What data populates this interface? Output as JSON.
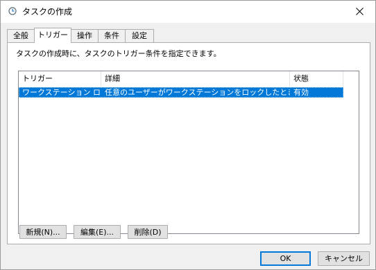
{
  "window": {
    "title": "タスクの作成"
  },
  "tabs": [
    {
      "label": "全般"
    },
    {
      "label": "トリガー"
    },
    {
      "label": "操作"
    },
    {
      "label": "条件"
    },
    {
      "label": "設定"
    }
  ],
  "panel": {
    "description": "タスクの作成時に、タスクのトリガー条件を指定できます。"
  },
  "table": {
    "columns": [
      "トリガー",
      "詳細",
      "状態"
    ],
    "rows": [
      {
        "trigger": "ワークステーション ロッ...",
        "detail": "任意のユーザーがワークステーションをロックしたとき",
        "status": "有効"
      }
    ]
  },
  "actions": {
    "new": "新規(N)...",
    "edit": "編集(E)...",
    "delete": "削除(D)"
  },
  "footer": {
    "ok": "OK",
    "cancel": "キャンセル"
  },
  "colors": {
    "accent": "#0078d7",
    "selection": "#0078d7"
  }
}
